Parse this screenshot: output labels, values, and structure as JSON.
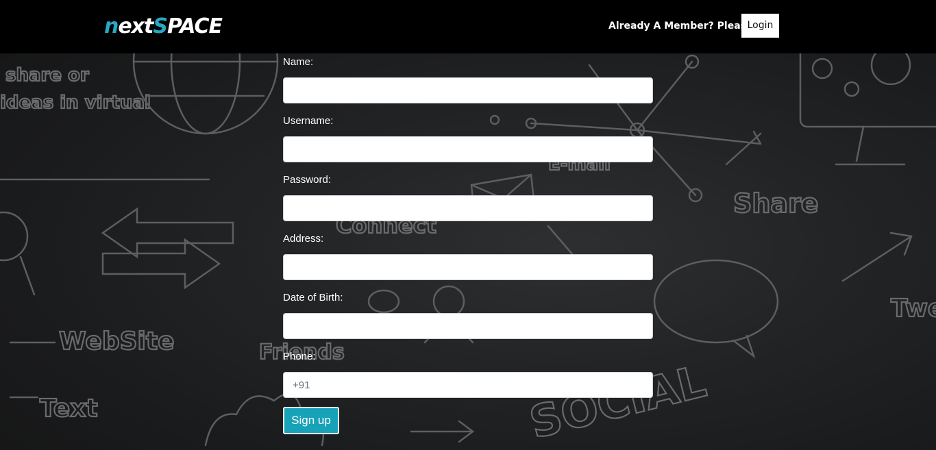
{
  "header": {
    "logo_prefix": "n",
    "logo_rest": "ext",
    "logo_accent_s": "S",
    "logo_end": "PACE",
    "member_prompt": "Already A Member? Please",
    "login_label": "Login"
  },
  "form": {
    "fields": [
      {
        "label": "Name:",
        "value": "",
        "placeholder": ""
      },
      {
        "label": "Username:",
        "value": "",
        "placeholder": ""
      },
      {
        "label": "Password:",
        "value": "",
        "placeholder": ""
      },
      {
        "label": "Address:",
        "value": "",
        "placeholder": ""
      },
      {
        "label": "Date of Birth:",
        "value": "",
        "placeholder": ""
      },
      {
        "label": "Phone:",
        "value": "",
        "placeholder": "+91"
      }
    ],
    "submit_label": "Sign up"
  },
  "background": {
    "doodle_words": [
      "share or",
      "ideas in virtual",
      "Connect",
      "E-mail",
      "Share",
      "WebSite",
      "Text",
      "Friends",
      "SOCIAL",
      "Twe"
    ]
  },
  "colors": {
    "accent": "#17a2b8",
    "logo_accent": "#25a9c4",
    "header_bg": "#000000"
  }
}
